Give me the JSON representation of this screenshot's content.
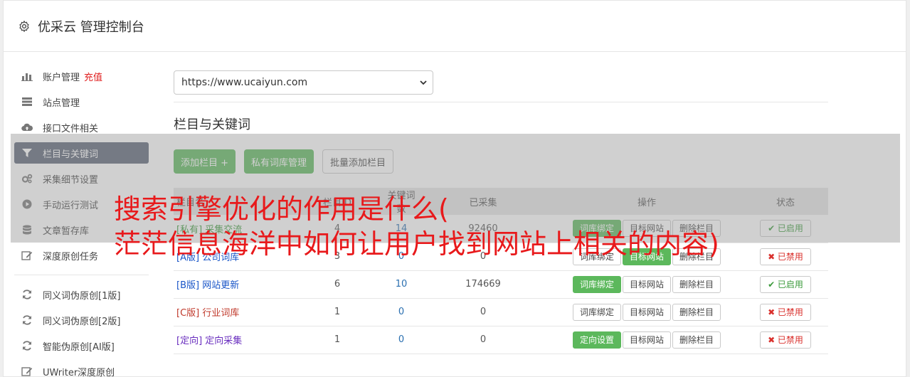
{
  "app": {
    "title": "优采云 管理控制台"
  },
  "sidebar": {
    "items": [
      {
        "label": "账户管理",
        "highlight": "充值",
        "icon": "bar-chart-icon"
      },
      {
        "label": "站点管理",
        "icon": "server-icon"
      },
      {
        "label": "接口文件相关",
        "icon": "cloud-upload-icon"
      },
      {
        "label": "栏目与关键词",
        "icon": "filter-icon",
        "active": true
      },
      {
        "label": "采集细节设置",
        "icon": "cogs-icon"
      },
      {
        "label": "手动运行测试",
        "icon": "play-circle-icon"
      },
      {
        "label": "文章暂存库",
        "icon": "database-icon"
      },
      {
        "label": "深度原创任务",
        "icon": "edit-icon"
      }
    ],
    "items2": [
      {
        "label": "同义词伪原创[1版]",
        "icon": "refresh-icon"
      },
      {
        "label": "同义词伪原创[2版]",
        "icon": "refresh-icon"
      },
      {
        "label": "智能伪原创[AI版]",
        "icon": "refresh-icon"
      },
      {
        "label": "UWriter深度原创",
        "icon": "edit-icon"
      }
    ]
  },
  "main": {
    "site_select": "https://www.ucaiyun.com",
    "section_title": "栏目与关键词",
    "buttons": {
      "add": "添加栏目 +",
      "private_lib": "私有词库管理",
      "batch_add": "批量添加栏目"
    },
    "table": {
      "headers": [
        "栏目名",
        "栏目ID",
        "关键词数",
        "已采集",
        "操作",
        "状态"
      ],
      "rows": [
        {
          "tag": "[私有]",
          "name": "采集交流",
          "id": "4",
          "kw": "14",
          "count": "92460",
          "op1": "词库绑定",
          "op2": "目标网站",
          "op3": "删除栏目",
          "status": "✔ 已启用",
          "on": true
        },
        {
          "tag": "[A版]",
          "name": "公司词库",
          "id": "3",
          "kw": "0",
          "count": "0",
          "op1": "词库绑定",
          "op2": "目标网站",
          "op3": "删除栏目",
          "status": "✖ 已禁用",
          "on": false
        },
        {
          "tag": "[B版]",
          "name": "网站更新",
          "id": "6",
          "kw": "10",
          "count": "174669",
          "op1": "词库绑定",
          "op2": "目标网站",
          "op3": "删除栏目",
          "status": "✔ 已启用",
          "on": true
        },
        {
          "tag": "[C版]",
          "name": "行业词库",
          "id": "1",
          "kw": "0",
          "count": "0",
          "op1": "词库绑定",
          "op2": "目标网站",
          "op3": "删除栏目",
          "status": "✖ 已禁用",
          "on": false
        },
        {
          "tag": "[定向]",
          "name": "定向采集",
          "id": "1",
          "kw": "0",
          "count": "0",
          "op1": "定向设置",
          "op2": "目标网站",
          "op3": "删除栏目",
          "status": "✖ 已禁用",
          "on": false
        }
      ]
    }
  },
  "overlay": {
    "line1": "搜索引擎优化的作用是什么(",
    "line2": "茫茫信息海洋中如何让用户找到网站上相关的内容)"
  },
  "colors": {
    "accent": "#5cb85c",
    "active_nav": "#5a6376",
    "banner_text": "#e8191b"
  }
}
